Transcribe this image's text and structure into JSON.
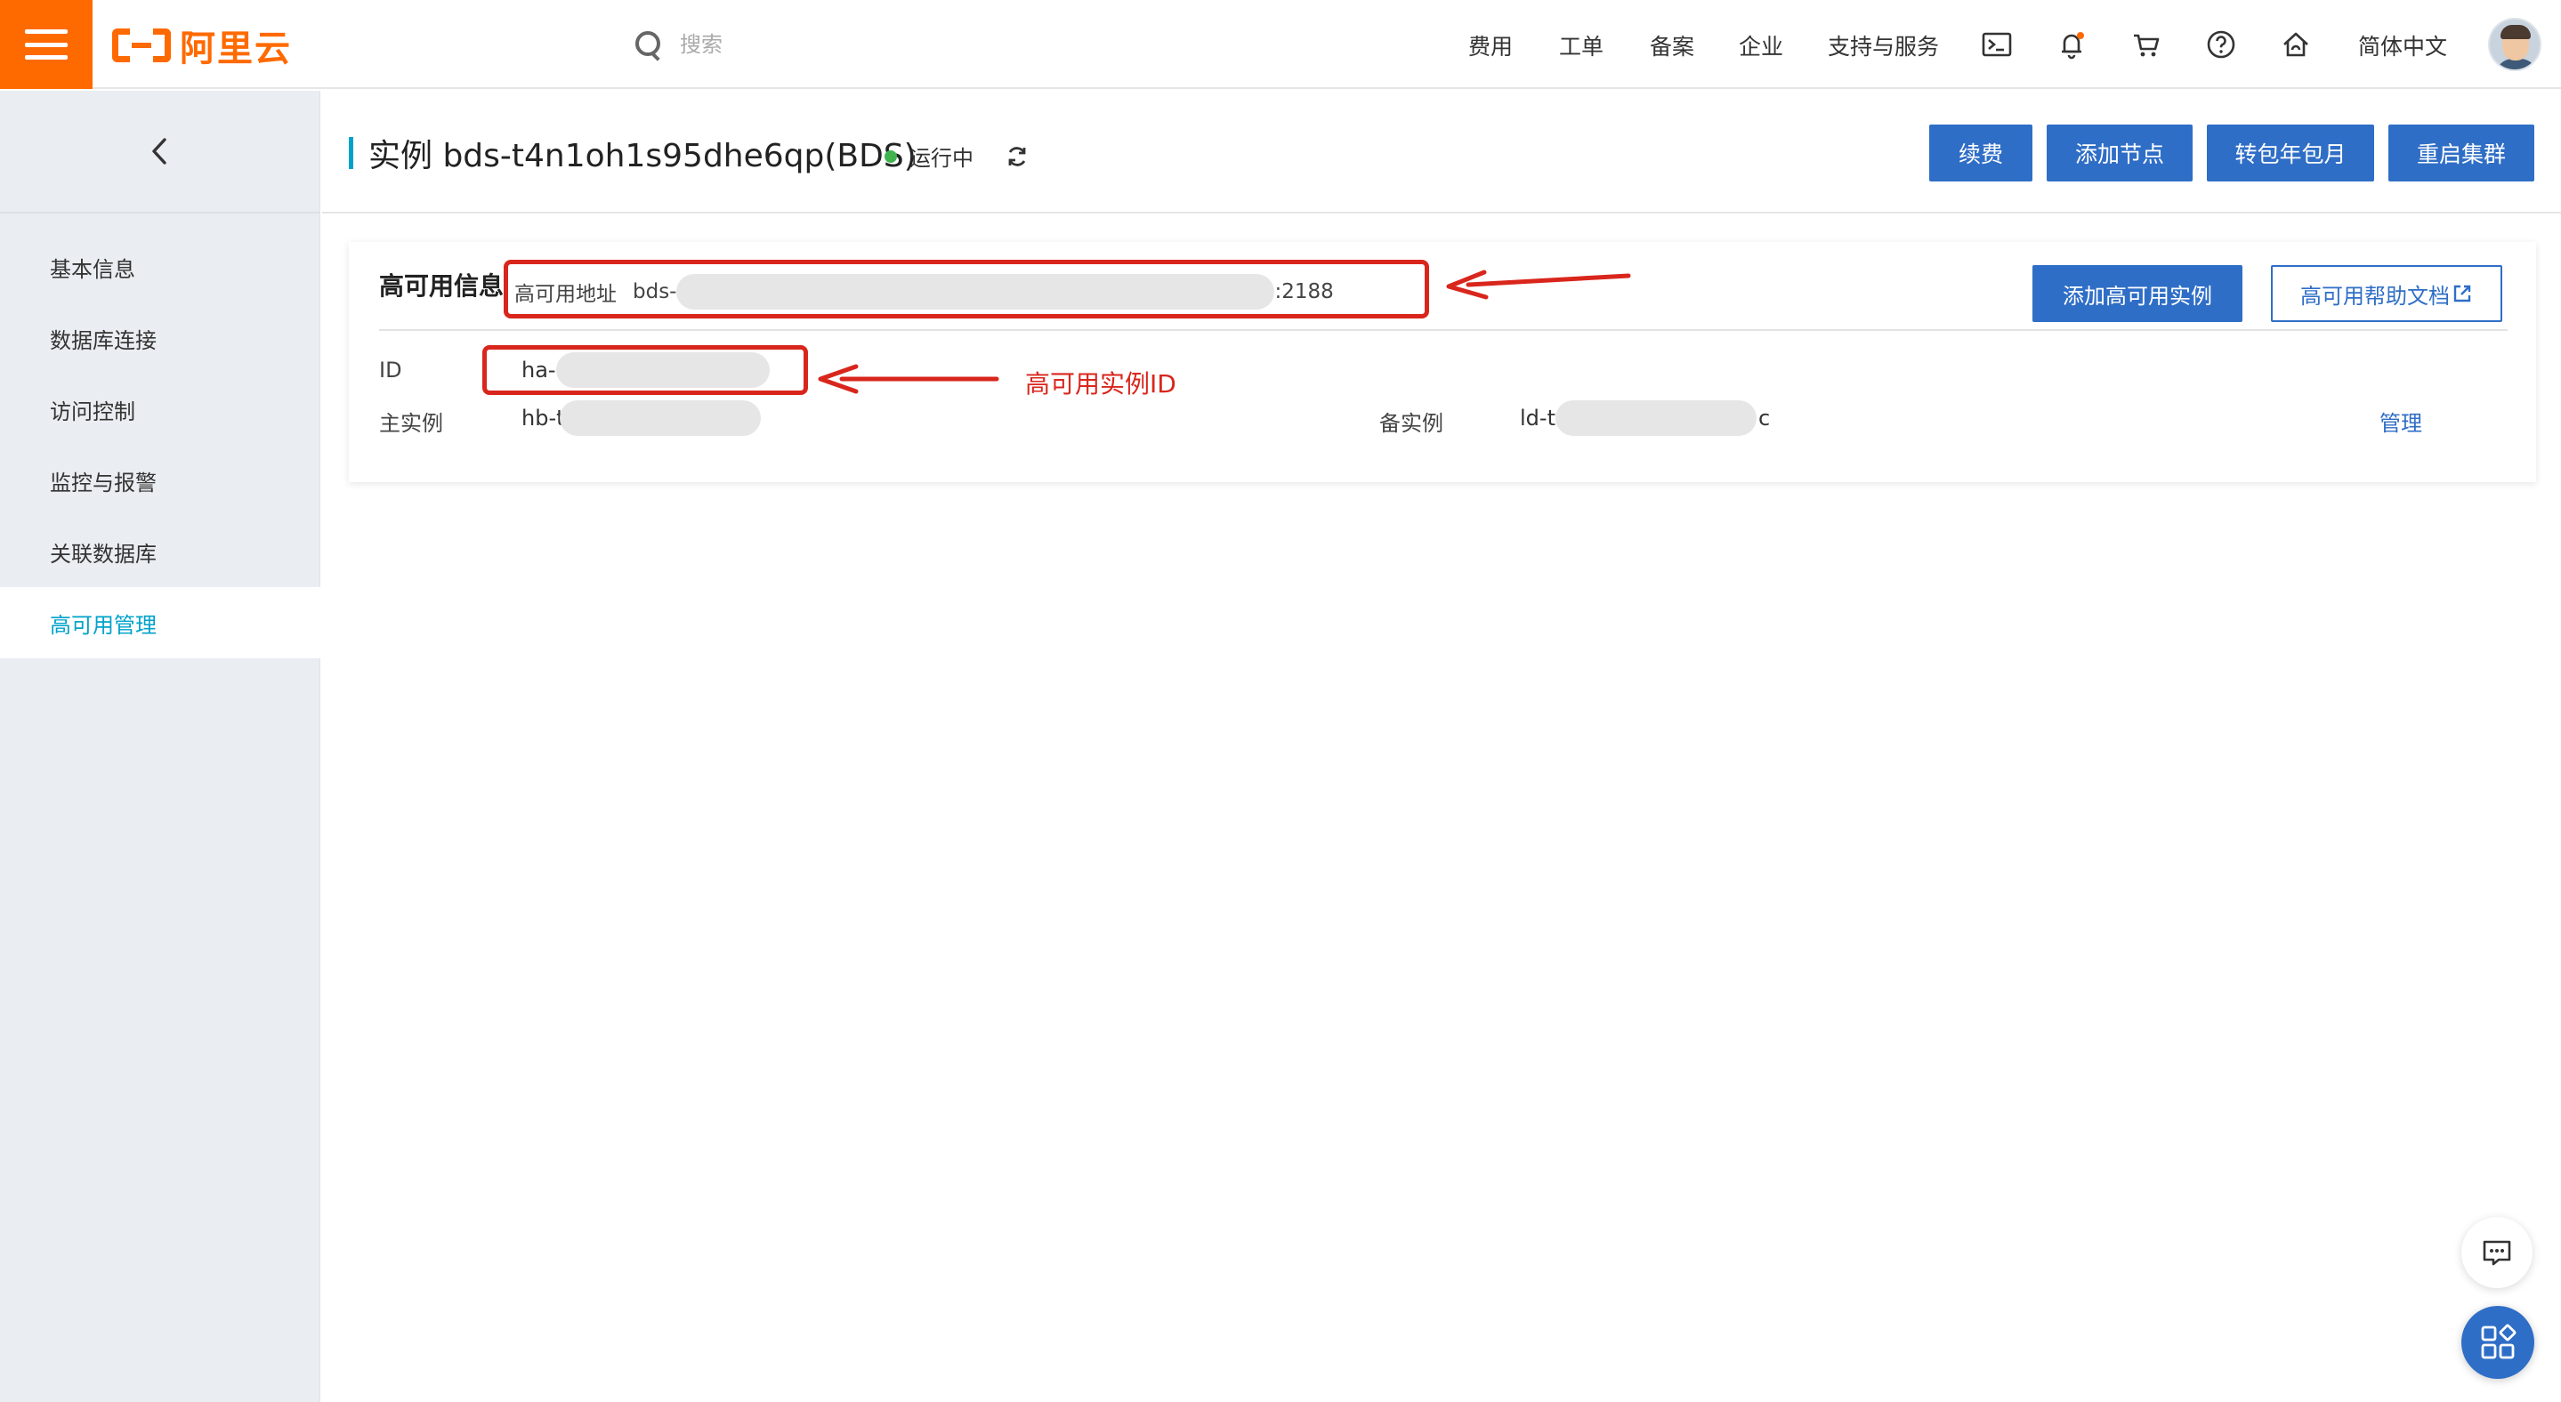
{
  "brand": {
    "name": "阿里云",
    "accent": "#ff6a00"
  },
  "search": {
    "placeholder": "搜索"
  },
  "topnav": {
    "links": [
      "费用",
      "工单",
      "备案",
      "企业",
      "支持与服务"
    ],
    "language": "简体中文",
    "icons": [
      "terminal-icon",
      "bell-icon",
      "cart-icon",
      "help-icon",
      "home-icon"
    ]
  },
  "sidebar": {
    "items": [
      {
        "label": "基本信息",
        "active": false
      },
      {
        "label": "数据库连接",
        "active": false
      },
      {
        "label": "访问控制",
        "active": false
      },
      {
        "label": "监控与报警",
        "active": false
      },
      {
        "label": "关联数据库",
        "active": false
      },
      {
        "label": "高可用管理",
        "active": true
      }
    ]
  },
  "header": {
    "title": "实例 bds-t4n1oh1s95dhe6qp(BDS)",
    "status": "运行中",
    "status_color": "#40b34f",
    "buttons": [
      "续费",
      "添加节点",
      "转包年包月",
      "重启集群"
    ]
  },
  "ha_card": {
    "title": "高可用信息",
    "address_label": "高可用地址",
    "address_prefix": "bds-",
    "address_suffix": ":2188",
    "add_button": "添加高可用实例",
    "help_button": "高可用帮助文档",
    "id_label": "ID",
    "id_prefix": "ha-",
    "primary_label": "主实例",
    "primary_prefix": "hb-t",
    "standby_label": "备实例",
    "standby_prefix": "ld-t",
    "standby_suffix": "c",
    "manage_link": "管理"
  },
  "annotation": {
    "text": "高可用实例ID",
    "color": "#d9261c"
  },
  "buttons_color": "#2f6ec6"
}
